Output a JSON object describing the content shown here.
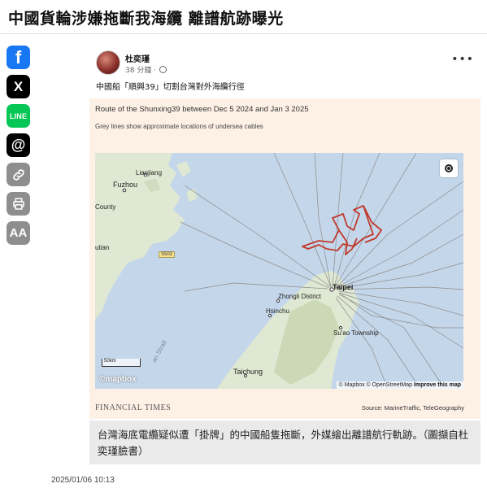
{
  "article": {
    "headline": "中國貨輪涉嫌拖斷我海纜 離譜航跡曝光",
    "date": "2025/01/06 10:13"
  },
  "share": {
    "facebook_icon": "f",
    "x_icon": "X",
    "line_label": "LINE",
    "threads_icon": "@",
    "font_size_label": "AA"
  },
  "post": {
    "author": "杜奕瑾",
    "time": "38 分鐘 ·",
    "text": "中國船「順興39」切割台灣對外海纜行徑",
    "more_label": "•••"
  },
  "figure": {
    "title": "Route of the Shunxing39 between Dec 5 2024 and Jan 3 2025",
    "subtitle": "Grey lines show approximate locations of undersea cables",
    "brand": "FINANCIAL TIMES",
    "source": "Source: MarineTraffic, TeleGeography",
    "map": {
      "labels": {
        "lianjiang": "Lianjiang",
        "fuzhou": "Fuzhou",
        "county": "County",
        "utian": "utian",
        "road": "S502",
        "zhongli": "Zhongli District",
        "taipei": "Taipei",
        "hsinchu": "Hsinchu",
        "suao": "Su'ao Township",
        "taichung": "Taichung",
        "strait": "Taiwan Strait",
        "sea_fragment": "an Strait"
      },
      "scale_label": "50km",
      "mapbox_logo": "©mapbox",
      "attribution_1": "© Mapbox © OpenStreetMap",
      "attribution_2": "Improve this map",
      "colors": {
        "sea": "#c4d6ea",
        "land": "#dfe8d2",
        "route": "#c0392b",
        "cable": "#8c8c8c"
      }
    }
  },
  "caption": "台灣海底電纜疑似遭「掛牌」的中國船隻拖斷，外媒繪出離譜航行軌跡。（圖擷自杜奕瑾臉書）"
}
